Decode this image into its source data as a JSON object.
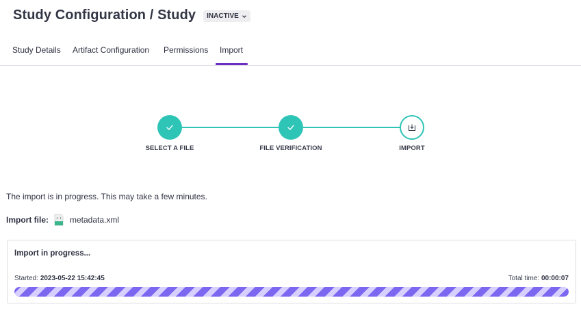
{
  "header": {
    "title": "Study Configuration / Study",
    "status": "INACTIVE"
  },
  "tabs": [
    {
      "label": "Study Details",
      "active": false
    },
    {
      "label": "Artifact Configuration",
      "active": false
    },
    {
      "label": "Permissions",
      "active": false
    },
    {
      "label": "Import",
      "active": true
    }
  ],
  "stepper": {
    "steps": [
      {
        "label": "SELECT A FILE",
        "state": "done",
        "icon": "check-icon"
      },
      {
        "label": "FILE VERIFICATION",
        "state": "done",
        "icon": "check-icon"
      },
      {
        "label": "IMPORT",
        "state": "current",
        "icon": "download-tray-icon"
      }
    ]
  },
  "main": {
    "message": "The import is in progress. This may take a few minutes.",
    "import_file_label": "Import file:",
    "file_name": "metadata.xml"
  },
  "progress": {
    "title": "Import in progress...",
    "started_label": "Started:",
    "started_value": "2023-05-22 15:42:45",
    "total_label": "Total time:",
    "total_value": "00:00:07",
    "fraction": 1.0
  },
  "colors": {
    "accent": "#6a2fc2",
    "teal": "#2ec4b6",
    "progress_stripe": "#7c67f0",
    "progress_bg": "#d7d0ff"
  }
}
